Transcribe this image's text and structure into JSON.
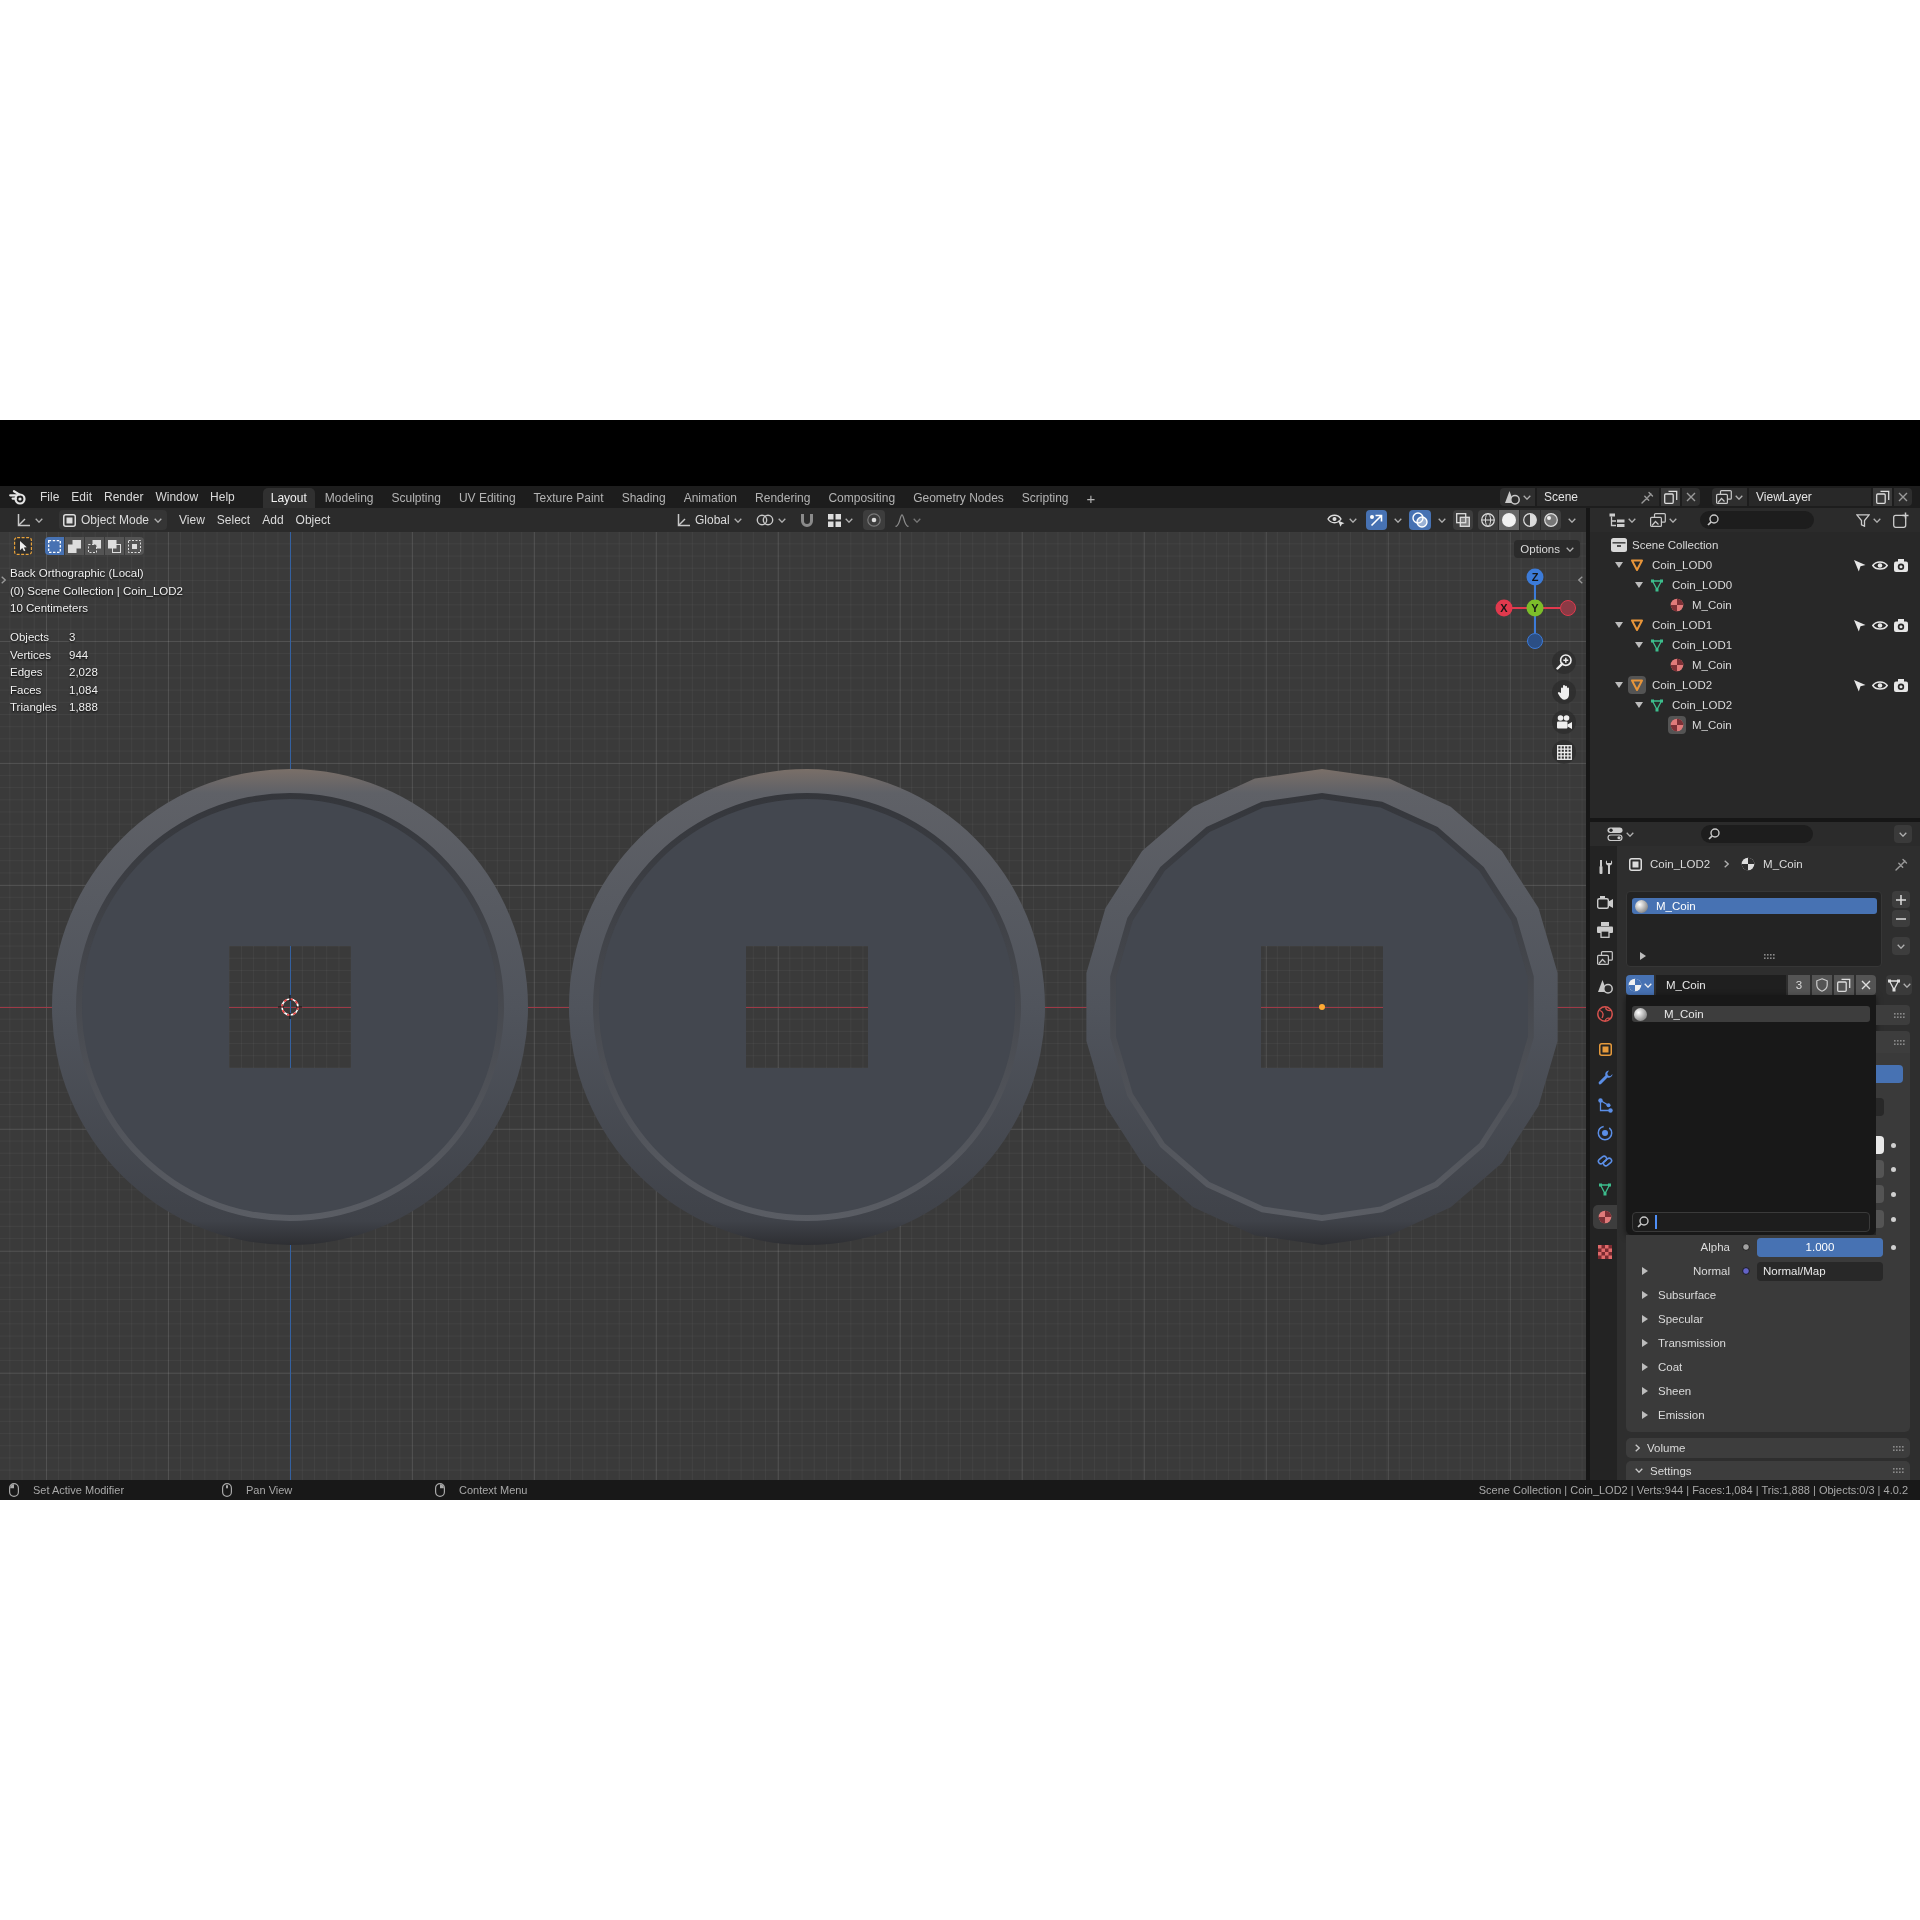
{
  "topbar": {
    "menus": [
      "File",
      "Edit",
      "Render",
      "Window",
      "Help"
    ],
    "workspaces": [
      {
        "label": "Layout",
        "selected": true
      },
      {
        "label": "Modeling",
        "selected": false
      },
      {
        "label": "Sculpting",
        "selected": false
      },
      {
        "label": "UV Editing",
        "selected": false
      },
      {
        "label": "Texture Paint",
        "selected": false
      },
      {
        "label": "Shading",
        "selected": false
      },
      {
        "label": "Animation",
        "selected": false
      },
      {
        "label": "Rendering",
        "selected": false
      },
      {
        "label": "Compositing",
        "selected": false
      },
      {
        "label": "Geometry Nodes",
        "selected": false
      },
      {
        "label": "Scripting",
        "selected": false
      }
    ],
    "add_workspace": "+",
    "scene": "Scene",
    "view_layer": "ViewLayer"
  },
  "viewport_header": {
    "mode": "Object Mode",
    "menus": [
      "View",
      "Select",
      "Add",
      "Object"
    ],
    "orientation": "Global",
    "toggles": [
      {
        "kind": "gizmos",
        "on": true
      },
      {
        "kind": "overlays",
        "on": true
      },
      {
        "kind": "xray",
        "on": false
      }
    ],
    "shading": [
      {
        "kind": "wireframe",
        "selected": false
      },
      {
        "kind": "solid",
        "selected": true
      },
      {
        "kind": "material",
        "selected": false
      },
      {
        "kind": "rendered",
        "selected": false
      }
    ]
  },
  "viewport": {
    "select_modes": [
      {
        "kind": "set",
        "selected": true
      },
      {
        "kind": "extend",
        "selected": false
      },
      {
        "kind": "subtract",
        "selected": false
      },
      {
        "kind": "invert",
        "selected": false
      },
      {
        "kind": "intersect",
        "selected": false
      }
    ],
    "view_name": "Back Orthographic (Local)",
    "collection": "(0) Scene Collection | Coin_LOD2",
    "grid_scale": "10 Centimeters",
    "stats": [
      {
        "label": "Objects",
        "value": "3"
      },
      {
        "label": "Vertices",
        "value": "944"
      },
      {
        "label": "Edges",
        "value": "2,028"
      },
      {
        "label": "Faces",
        "value": "1,084"
      },
      {
        "label": "Triangles",
        "value": "1,888"
      }
    ],
    "options": "Options",
    "gizmo_axes": [
      {
        "kind": "z",
        "label": "Z"
      },
      {
        "kind": "x",
        "label": "X"
      },
      {
        "kind": "y",
        "label": "Y"
      }
    ],
    "coins": [
      {
        "kind": "smooth",
        "selected": false
      },
      {
        "kind": "smooth",
        "selected": false
      },
      {
        "kind": "faceted",
        "selected": true
      }
    ]
  },
  "outliner": {
    "root": "Scene Collection",
    "items": [
      {
        "label": "Coin_LOD0",
        "kind": "object",
        "active": false,
        "expanded": true,
        "children": [
          {
            "label": "Coin_LOD0",
            "kind": "mesh",
            "expanded": true,
            "children": [
              {
                "label": "M_Coin",
                "kind": "material",
                "active": false
              }
            ]
          }
        ]
      },
      {
        "label": "Coin_LOD1",
        "kind": "object",
        "active": false,
        "expanded": true,
        "children": [
          {
            "label": "Coin_LOD1",
            "kind": "mesh",
            "expanded": true,
            "children": [
              {
                "label": "M_Coin",
                "kind": "material",
                "active": false
              }
            ]
          }
        ]
      },
      {
        "label": "Coin_LOD2",
        "kind": "object",
        "active": true,
        "expanded": true,
        "children": [
          {
            "label": "Coin_LOD2",
            "kind": "mesh",
            "expanded": true,
            "children": [
              {
                "label": "M_Coin",
                "kind": "material",
                "active": true
              }
            ]
          }
        ]
      }
    ]
  },
  "properties": {
    "tab_groups": [
      {
        "tabs": [
          {
            "kind": "tool",
            "selected": false
          }
        ]
      },
      {
        "tabs": [
          {
            "kind": "render",
            "selected": false
          },
          {
            "kind": "output",
            "selected": false
          },
          {
            "kind": "view_layer",
            "selected": false
          },
          {
            "kind": "scene",
            "selected": false
          },
          {
            "kind": "world",
            "selected": false
          }
        ]
      },
      {
        "tabs": [
          {
            "kind": "object",
            "selected": false
          },
          {
            "kind": "modifiers",
            "selected": false
          },
          {
            "kind": "particles",
            "selected": false
          },
          {
            "kind": "physics",
            "selected": false
          },
          {
            "kind": "constraints",
            "selected": false
          },
          {
            "kind": "data",
            "selected": false
          },
          {
            "kind": "material",
            "selected": true
          }
        ]
      },
      {
        "tabs": [
          {
            "kind": "texture",
            "selected": false
          }
        ]
      }
    ],
    "breadcrumb": [
      {
        "kind": "object",
        "label": "Coin_LOD2"
      },
      {
        "kind": "material",
        "label": "M_Coin"
      }
    ],
    "material_slots": [
      {
        "label": "M_Coin",
        "selected": true
      }
    ],
    "material": {
      "name": "M_Coin",
      "users": "3"
    },
    "material_menu": {
      "items": [
        {
          "label": "M_Coin",
          "selected": true
        }
      ]
    },
    "inputs": [
      {
        "kind": "slider",
        "label": "Alpha",
        "value": "1.000",
        "level": 1
      },
      {
        "kind": "link",
        "label": "Normal",
        "value": "Normal/Map",
        "expanded": false
      }
    ],
    "subpanels": [
      {
        "label": "Subsurface",
        "expanded": false
      },
      {
        "label": "Specular",
        "expanded": false
      },
      {
        "label": "Transmission",
        "expanded": false
      },
      {
        "label": "Coat",
        "expanded": false
      },
      {
        "label": "Sheen",
        "expanded": false
      },
      {
        "label": "Emission",
        "expanded": false
      }
    ],
    "panels": [
      {
        "label": "Volume",
        "expanded": false
      },
      {
        "label": "Settings",
        "expanded": true
      }
    ]
  },
  "status_bar": {
    "hints": [
      {
        "kind": "left_click",
        "label": "Set Active Modifier"
      },
      {
        "kind": "middle_click",
        "label": "Pan View"
      },
      {
        "kind": "right_click",
        "label": "Context Menu"
      }
    ],
    "info": "Scene Collection | Coin_LOD2 | Verts:944 | Faces:1,084 | Tris:1,888 | Objects:0/3 | 4.0.2"
  }
}
